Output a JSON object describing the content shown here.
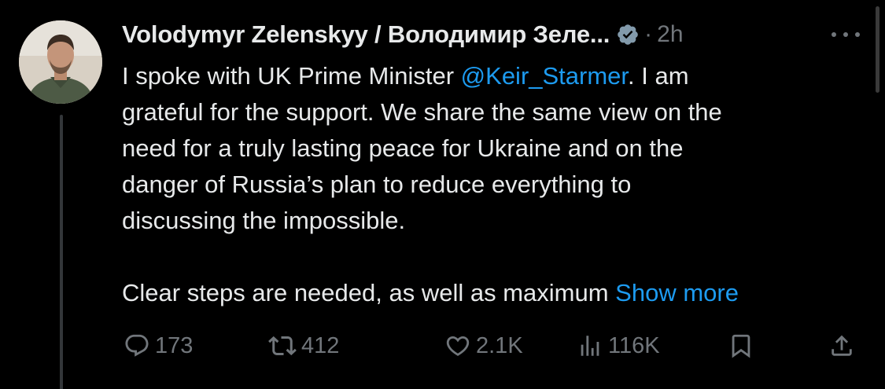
{
  "tweet": {
    "author_name": "Volodymyr Zelenskyy / Володимир Зеле...",
    "separator": "·",
    "time": "2h",
    "body_lines": [
      {
        "before": "I spoke with UK Prime Minister ",
        "mention": "@Keir_Starmer",
        "after": ". I am"
      },
      "grateful for the support. We share the same view on the",
      "need for a truly lasting peace for Ukraine and on the",
      "danger of Russia’s plan to reduce everything to",
      "discussing the impossible."
    ],
    "last_line": "Clear steps are needed, as well as maximum ",
    "show_more": "Show more"
  },
  "actions": {
    "replies": "173",
    "reposts": "412",
    "likes": "2.1K",
    "views": "116K"
  },
  "colors": {
    "background": "#000000",
    "text": "#e7e9ea",
    "secondary": "#71767b",
    "accent": "#1d9bf0"
  },
  "icons": [
    "verified-badge-icon",
    "more-options-icon",
    "reply-icon",
    "repost-icon",
    "like-icon",
    "views-icon",
    "bookmark-icon",
    "share-icon"
  ]
}
